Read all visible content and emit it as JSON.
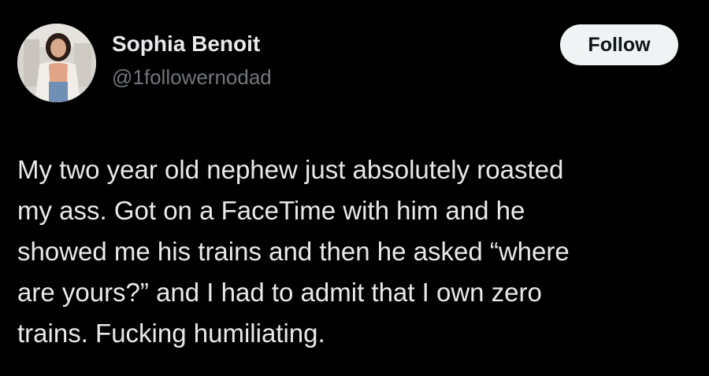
{
  "author": {
    "display_name": "Sophia Benoit",
    "handle": "@1followernodad"
  },
  "follow_button": {
    "label": "Follow"
  },
  "tweet": {
    "lines": [
      "My two year old nephew just absolutely roasted",
      "my ass. Got on a FaceTime with him and he",
      "showed me his trains and then he asked “where",
      "are yours?” and I had to admit that I own zero",
      "trains. Fucking humiliating."
    ]
  },
  "colors": {
    "background": "#000000",
    "primary_text": "#e7e9ea",
    "secondary_text": "#71767b",
    "follow_button_bg": "#eff3f4",
    "follow_button_text": "#0f1419"
  }
}
